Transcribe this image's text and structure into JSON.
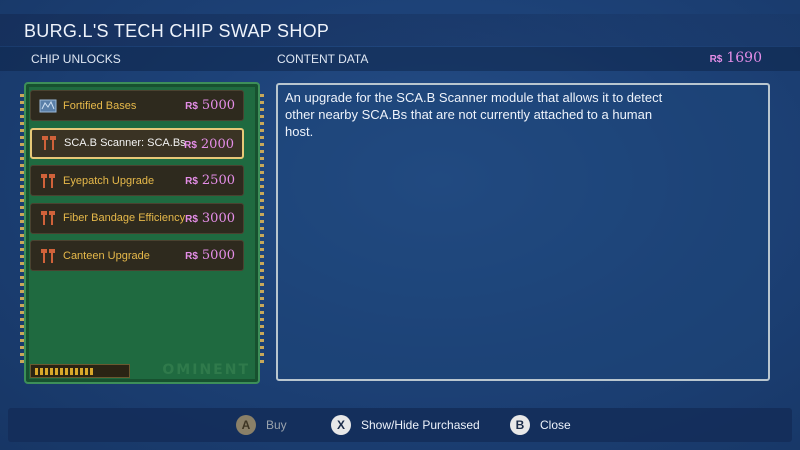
{
  "header": {
    "title": "BURG.L'S TECH CHIP SWAP SHOP",
    "left_label": "CHIP UNLOCKS",
    "mid_label": "CONTENT DATA",
    "currency_symbol": "R$",
    "currency_amount": "1690"
  },
  "chips": [
    {
      "name": "Fortified Bases",
      "symbol": "R$",
      "price": "5000",
      "icon": "blueprint-icon",
      "selected": false
    },
    {
      "name": "SCA.B Scanner: SCA.Bs",
      "symbol": "R$",
      "price": "2000",
      "icon": "tool-icon",
      "selected": true
    },
    {
      "name": "Eyepatch Upgrade",
      "symbol": "R$",
      "price": "2500",
      "icon": "tool-icon",
      "selected": false
    },
    {
      "name": "Fiber Bandage Efficiency",
      "symbol": "R$",
      "price": "3000",
      "icon": "tool-icon",
      "selected": false
    },
    {
      "name": "Canteen Upgrade",
      "symbol": "R$",
      "price": "5000",
      "icon": "tool-icon",
      "selected": false
    }
  ],
  "board_brand": "OMINENT",
  "content": {
    "description": "An upgrade for the SCA.B Scanner module that allows it to detect other nearby SCA.Bs that are not currently attached to a human host."
  },
  "controls": {
    "buy": {
      "glyph": "A",
      "label": "Buy"
    },
    "toggle": {
      "glyph": "X",
      "label": "Show/Hide Purchased"
    },
    "close": {
      "glyph": "B",
      "label": "Close"
    }
  },
  "colors": {
    "price": "#e58ee8",
    "chip_text": "#e7b94a",
    "board": "#1f6a40",
    "selected_border": "#e8c877"
  }
}
